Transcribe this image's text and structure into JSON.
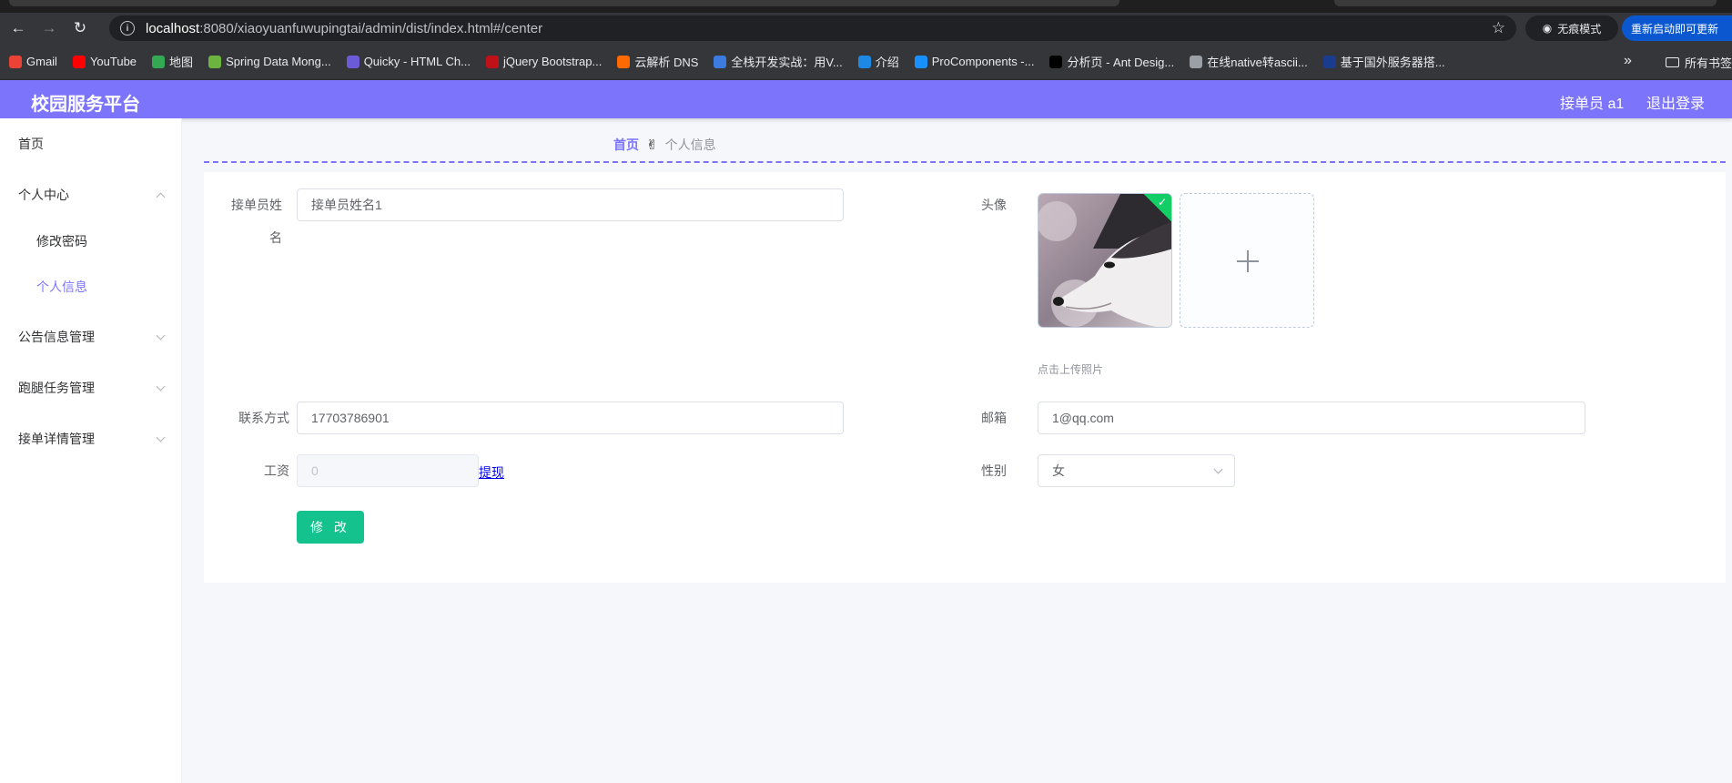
{
  "browser": {
    "url_host": "localhost",
    "url_path": ":8080/xiaoyuanfuwupingtai/admin/dist/index.html#/center",
    "incognito_label": "无痕模式",
    "update_label": "重新启动即可更新",
    "bookmarks": [
      {
        "icon": "gmail-icon",
        "label": "Gmail",
        "color": "#ea4335"
      },
      {
        "icon": "youtube-icon",
        "label": "YouTube",
        "color": "#ff0000"
      },
      {
        "icon": "maps-icon",
        "label": "地图",
        "color": "#34a853"
      },
      {
        "icon": "spring-icon",
        "label": "Spring Data Mong...",
        "color": "#6db33f"
      },
      {
        "icon": "quicky-icon",
        "label": "Quicky - HTML Ch...",
        "color": "#6b5bd6"
      },
      {
        "icon": "jquery-icon",
        "label": "jQuery Bootstrap...",
        "color": "#c0101a"
      },
      {
        "icon": "aliyun-icon",
        "label": "云解析 DNS",
        "color": "#ff6a00"
      },
      {
        "icon": "m-icon",
        "label": "全栈开发实战：用V...",
        "color": "#3c7be0"
      },
      {
        "icon": "globe-blue-icon",
        "label": "介绍",
        "color": "#1e88e5"
      },
      {
        "icon": "procomponents-icon",
        "label": "ProComponents -...",
        "color": "#1890ff"
      },
      {
        "icon": "pro-icon",
        "label": "分析页 - Ant Desig...",
        "color": "#000000"
      },
      {
        "icon": "globe-icon",
        "label": "在线native转ascii...",
        "color": "#9aa0a6"
      },
      {
        "icon": "flag-icon",
        "label": "基于国外服务器搭...",
        "color": "#1a3c8f"
      }
    ],
    "all_bookmarks_label": "所有书签"
  },
  "header": {
    "title": "校园服务平台",
    "user": "接单员 a1",
    "logout": "退出登录"
  },
  "sidebar": {
    "items": [
      {
        "label": "首页"
      },
      {
        "label": "个人中心"
      },
      {
        "label": "修改密码"
      },
      {
        "label": "个人信息"
      },
      {
        "label": "公告信息管理"
      },
      {
        "label": "跑腿任务管理"
      },
      {
        "label": "接单详情管理"
      }
    ]
  },
  "breadcrumb": {
    "home": "首页",
    "separator": "✌",
    "current": "个人信息"
  },
  "form": {
    "name_label_line1": "接单员姓",
    "name_label_line2": "名",
    "name_value": "接单员姓名1",
    "avatar_label": "头像",
    "upload_tip": "点击上传照片",
    "phone_label": "联系方式",
    "phone_value": "17703786901",
    "email_label": "邮箱",
    "email_value": "1@qq.com",
    "salary_label": "工资",
    "salary_value": "0",
    "withdraw_link": "提现",
    "gender_label": "性别",
    "gender_value": "女",
    "submit_label": "修 改"
  },
  "colors": {
    "accent": "#7c74fb",
    "success": "#13c28c"
  }
}
